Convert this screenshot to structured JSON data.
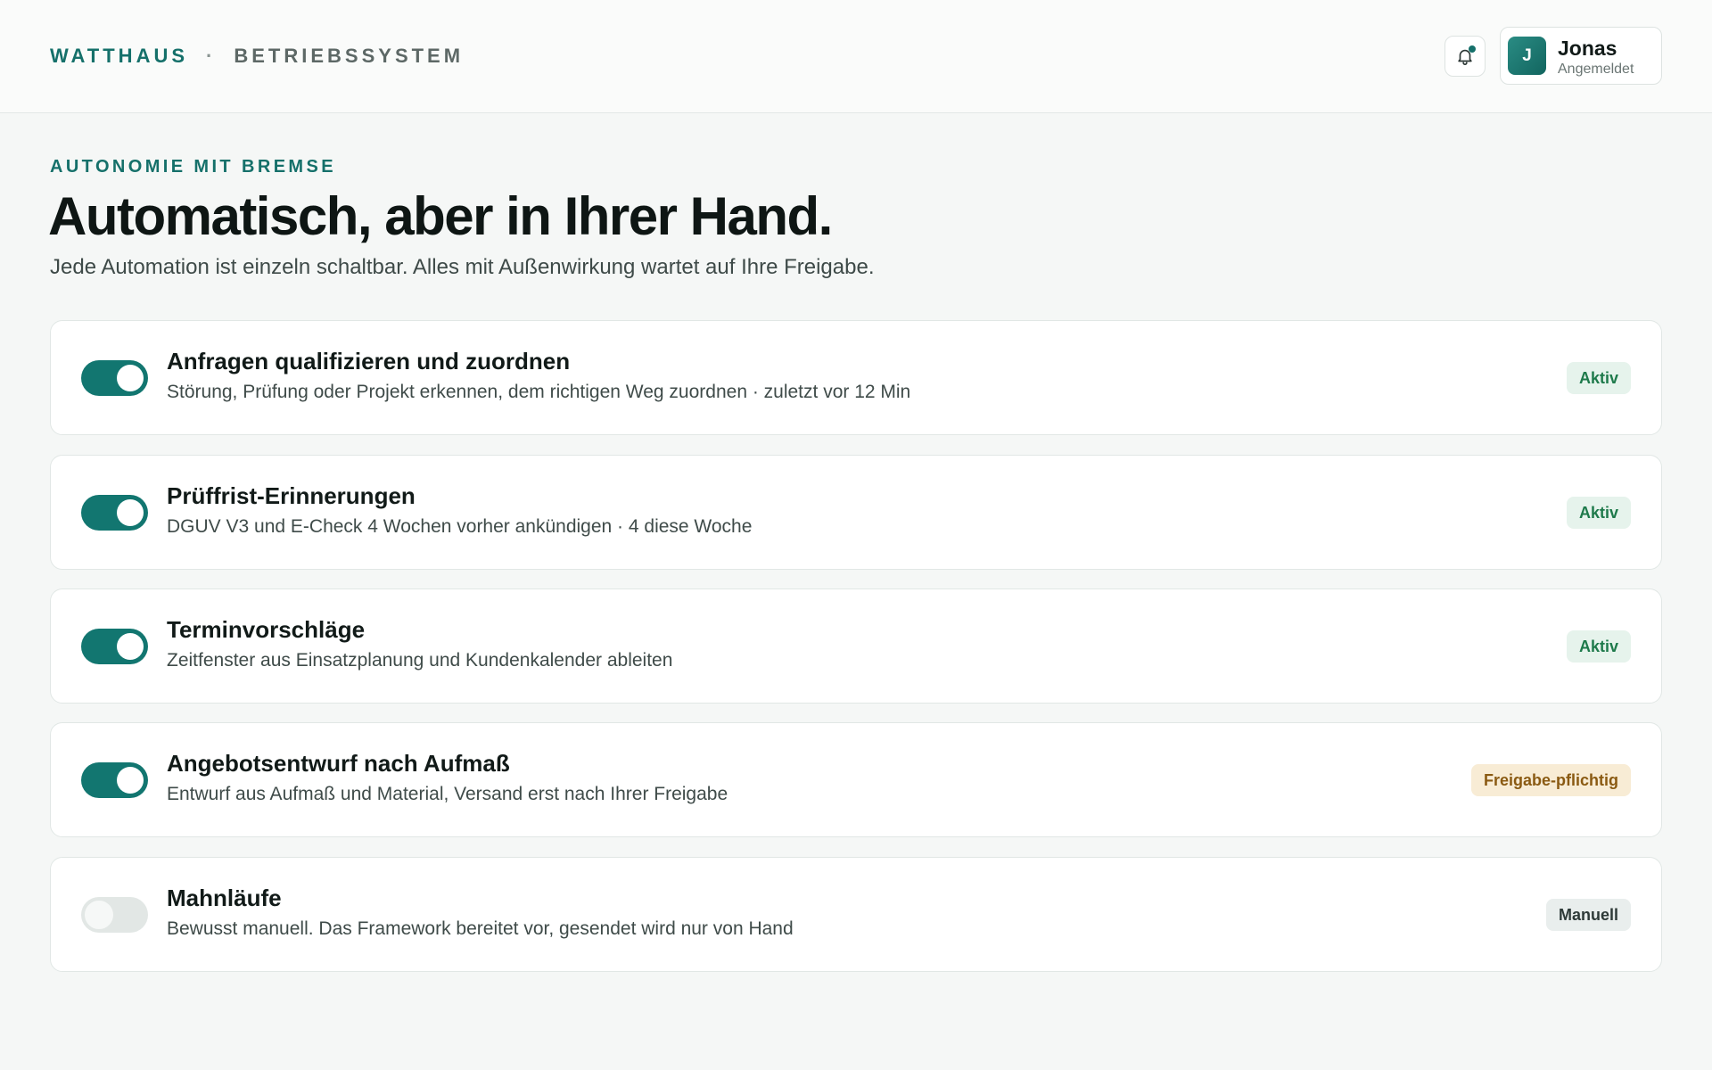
{
  "header": {
    "brand_name": "WATTHAUS",
    "brand_separator": "·",
    "brand_sub": "BETRIEBSSYSTEM",
    "notifications_icon": "bell-icon",
    "user": {
      "initial": "J",
      "name": "Jonas",
      "status": "Angemeldet"
    }
  },
  "intro": {
    "eyebrow": "AUTONOMIE MIT BREMSE",
    "headline": "Automatisch, aber in Ihrer Hand.",
    "subline": "Jede Automation ist einzeln schaltbar. Alles mit Außenwirkung wartet auf Ihre Freigabe."
  },
  "automations": [
    {
      "title": "Anfragen qualifizieren und zuordnen",
      "description": "Störung, Prüfung oder Projekt erkennen, dem richtigen Weg zuordnen · zuletzt vor 12 Min",
      "enabled": true,
      "badge": "Aktiv",
      "badge_type": "aktiv"
    },
    {
      "title": "Prüffrist-Erinnerungen",
      "description": "DGUV V3 und E-Check 4 Wochen vorher ankündigen · 4 diese Woche",
      "enabled": true,
      "badge": "Aktiv",
      "badge_type": "aktiv"
    },
    {
      "title": "Terminvorschläge",
      "description": "Zeitfenster aus Einsatzplanung und Kundenkalender ableiten",
      "enabled": true,
      "badge": "Aktiv",
      "badge_type": "aktiv"
    },
    {
      "title": "Angebotsentwurf nach Aufmaß",
      "description": "Entwurf aus Aufmaß und Material, Versand erst nach Ihrer Freigabe",
      "enabled": true,
      "badge": "Freigabe-pflichtig",
      "badge_type": "freigabe"
    },
    {
      "title": "Mahnläufe",
      "description": "Bewusst manuell. Das Framework bereitet vor, gesendet wird nur von Hand",
      "enabled": false,
      "badge": "Manuell",
      "badge_type": "manuell"
    }
  ],
  "colors": {
    "accent": "#15706a",
    "toggle_on": "#127670",
    "toggle_off": "#e2e7e5",
    "badge_aktiv_bg": "#e6f3ec",
    "badge_freigabe_bg": "#f8ecd5",
    "badge_manuell_bg": "#e9eeed"
  }
}
